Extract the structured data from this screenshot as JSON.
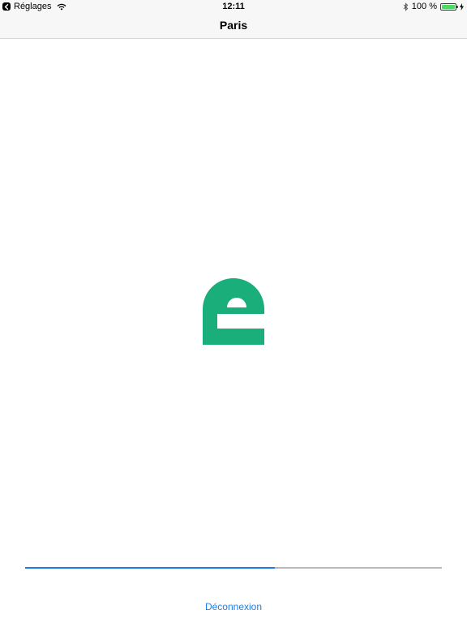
{
  "status_bar": {
    "back_app_label": "Réglages",
    "time": "12:11",
    "battery_text": "100 %",
    "battery_level": 1.0,
    "icons": [
      "back-chevron-icon",
      "wifi-icon",
      "bluetooth-icon",
      "battery-icon",
      "charging-bolt-icon"
    ]
  },
  "nav": {
    "title": "Paris"
  },
  "logo": {
    "icon": "app-logo-icon",
    "color": "#1aae7a"
  },
  "progress": {
    "value": 0.6
  },
  "actions": {
    "logout_label": "Déconnexion"
  },
  "colors": {
    "accent": "#1f7ee6",
    "brand": "#1aae7a",
    "battery": "#4cd964"
  }
}
